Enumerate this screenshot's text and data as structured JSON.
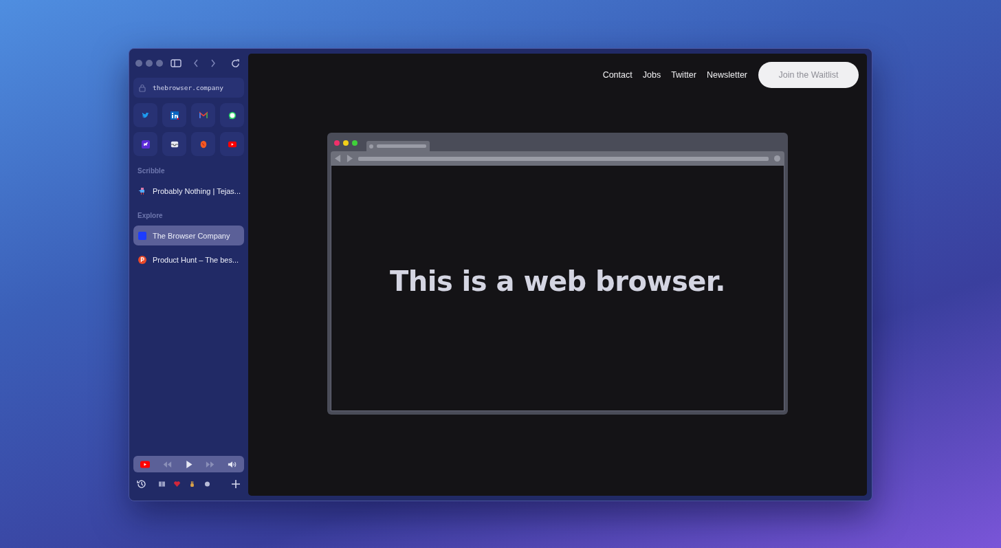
{
  "sidebar": {
    "url": "thebrowser.company",
    "sections": [
      {
        "title": "Scribble",
        "items": [
          {
            "title": "Probably Nothing | Tejas...",
            "selected": false
          }
        ]
      },
      {
        "title": "Explore",
        "items": [
          {
            "title": "The Browser Company",
            "selected": true
          },
          {
            "title": "Product Hunt – The bes...",
            "selected": false
          }
        ]
      }
    ]
  },
  "page": {
    "nav": [
      "Contact",
      "Jobs",
      "Twitter",
      "Newsletter"
    ],
    "cta": "Join the Waitlist",
    "headline": "This is a web browser."
  }
}
